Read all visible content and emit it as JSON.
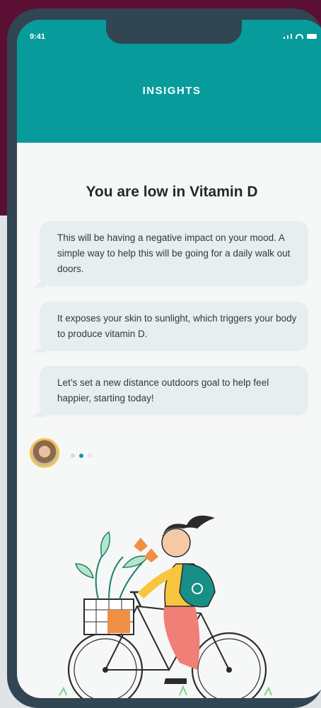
{
  "status_bar": {
    "time": "9:41"
  },
  "header": {
    "title": "INSIGHTS"
  },
  "headline": "You are low in Vitamin D",
  "messages": [
    {
      "text": "This will be having a negative impact on your mood. A simple way to help this will be going for a daily walk out doors."
    },
    {
      "text": "It exposes your skin to sunlight, which triggers your body to produce vitamin D."
    },
    {
      "text": "Let’s set a new distance outdoors goal to help feel happier, starting today!"
    }
  ],
  "colors": {
    "accent": "#079b9c",
    "background": "#5a0f33",
    "bubble": "#e7eef0",
    "avatar_ring": "#f2c44c"
  },
  "icons": [
    "signal-icon",
    "wifi-icon",
    "battery-icon",
    "avatar",
    "typing-indicator"
  ]
}
